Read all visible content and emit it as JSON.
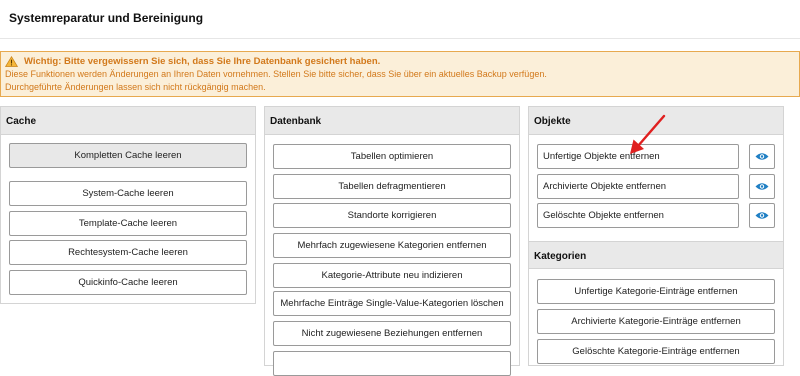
{
  "page": {
    "title": "Systemreparatur und Bereinigung"
  },
  "warning": {
    "headline": "Wichtig: Bitte vergewissern Sie sich, dass Sie Ihre Datenbank gesichert haben.",
    "line1": "Diese Funktionen werden Änderungen an Ihren Daten vornehmen. Stellen Sie bitte sicher, dass Sie über ein aktuelles Backup verfügen.",
    "line2": "Durchgeführte Änderungen lassen sich nicht rückgängig machen.",
    "icon": "warning-triangle-icon",
    "color": "#d2791b"
  },
  "cache": {
    "title": "Cache",
    "buttons": [
      "Kompletten Cache leeren",
      "System-Cache leeren",
      "Template-Cache leeren",
      "Rechtesystem-Cache leeren",
      "Quickinfo-Cache leeren"
    ]
  },
  "datenbank": {
    "title": "Datenbank",
    "buttons": [
      "Tabellen optimieren",
      "Tabellen defragmentieren",
      "Standorte korrigieren",
      "Mehrfach zugewiesene Kategorien entfernen",
      "Kategorie-Attribute neu indizieren",
      "Mehrfache Einträge Single-Value-Kategorien löschen",
      "Nicht zugewiesene Beziehungen entfernen"
    ]
  },
  "objekte": {
    "title": "Objekte",
    "buttons": [
      "Unfertige Objekte entfernen",
      "Archivierte Objekte entfernen",
      "Gelöschte Objekte entfernen"
    ],
    "view_icon": "eye-icon"
  },
  "kategorien": {
    "title": "Kategorien",
    "buttons": [
      "Unfertige Kategorie-Einträge entfernen",
      "Archivierte Kategorie-Einträge entfernen",
      "Gelöschte Kategorie-Einträge entfernen"
    ]
  },
  "annotation": {
    "arrow_color": "#e02020"
  }
}
